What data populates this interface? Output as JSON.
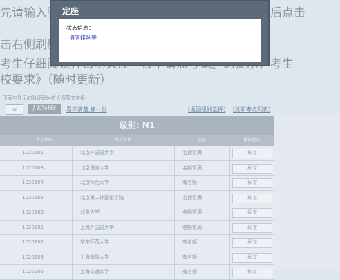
{
  "background": {
    "line1": "先请输入验证码，再点选择您要参加申请的考点，最后点击",
    "line2": "击右侧刷新，如果您已经回到下面的考点列表",
    "line3": "考生仔细阅读并密切关注『各申请点考试』的提示，考生",
    "line4": "校要求》（随时更新）",
    "captcha_hint": "下面中显示的验证码(4位大写英文字母)",
    "captcha_value": "jai",
    "captcha_image_text": "J K%Hs",
    "refresh_captcha_link": "看不清楚,换一张",
    "back_link": "[返回级别选择]",
    "refresh_list_link": "[刷新考点列表]"
  },
  "table": {
    "grade_title": "级别:   N1",
    "headers": {
      "code": "考点代码",
      "name": "考点名称",
      "status": "状态",
      "action": "报位提位"
    },
    "rows": [
      {
        "code": "1020101",
        "name": "北京外国语大学",
        "status": "名额暂满",
        "action": "报 定"
      },
      {
        "code": "1020103",
        "name": "北京语言大学",
        "status": "名额暂满",
        "action": "报 定"
      },
      {
        "code": "1020104",
        "name": "北京师范大学",
        "status": "有名额",
        "action": "报 定"
      },
      {
        "code": "1020105",
        "name": "北京第二外国语学院",
        "status": "名额暂满",
        "action": "报 定"
      },
      {
        "code": "1020106",
        "name": "北京大学",
        "status": "名额暂满",
        "action": "报 定"
      },
      {
        "code": "1020201",
        "name": "上海外国语大学",
        "status": "名额暂满",
        "action": "报 定"
      },
      {
        "code": "1020202",
        "name": "华东师范大学",
        "status": "有名额",
        "action": "报 定"
      },
      {
        "code": "1020203",
        "name": "上海海事大学",
        "status": "有名额",
        "action": "报 定"
      },
      {
        "code": "1020205",
        "name": "上海交通大学",
        "status": "有名额",
        "action": "报 定"
      }
    ]
  },
  "dialog": {
    "title": "定座",
    "status_label": "状态信息：",
    "status_message": "请求排队中……"
  }
}
